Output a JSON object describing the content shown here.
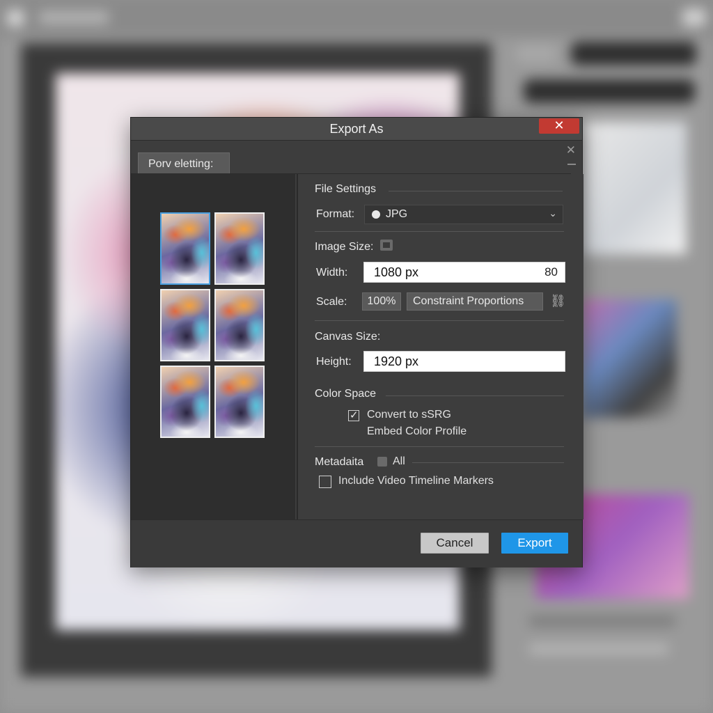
{
  "dialog": {
    "title": "Export As",
    "close_glyph": "✕",
    "secondary_close_glyph": "✕",
    "preview_tab_label": "Porv eletting:"
  },
  "preview": {
    "thumbnail_count": 6,
    "selected_index": 0
  },
  "file_settings": {
    "section_title": "File Settings",
    "format_label": "Format:",
    "format_value": "JPG",
    "format_chevron": "⌄"
  },
  "image_size": {
    "section_title": "Image Size:",
    "width_label": "Width:",
    "width_value": "1080 px",
    "width_suffix": "80",
    "scale_label": "Scale:",
    "scale_value": "100%",
    "constrain_label": "Constraint Proportions",
    "link_icon": "⛓"
  },
  "canvas_size": {
    "section_title": "Canvas Size:",
    "height_label": "Height:",
    "height_value": "1920 px"
  },
  "color_space": {
    "section_title": "Color Space",
    "convert_label": "Convert to sSRG",
    "convert_checked": true,
    "embed_label": "Embed Color Profile"
  },
  "metadata": {
    "section_title": "Metadaita",
    "all_label": "All",
    "include_label": "Include Video Timeline Markers",
    "include_checked": false
  },
  "footer": {
    "cancel_label": "Cancel",
    "export_label": "Export"
  },
  "colors": {
    "accent": "#1f96e8",
    "close": "#c23a32",
    "dialog_bg": "#3d3d3d"
  }
}
